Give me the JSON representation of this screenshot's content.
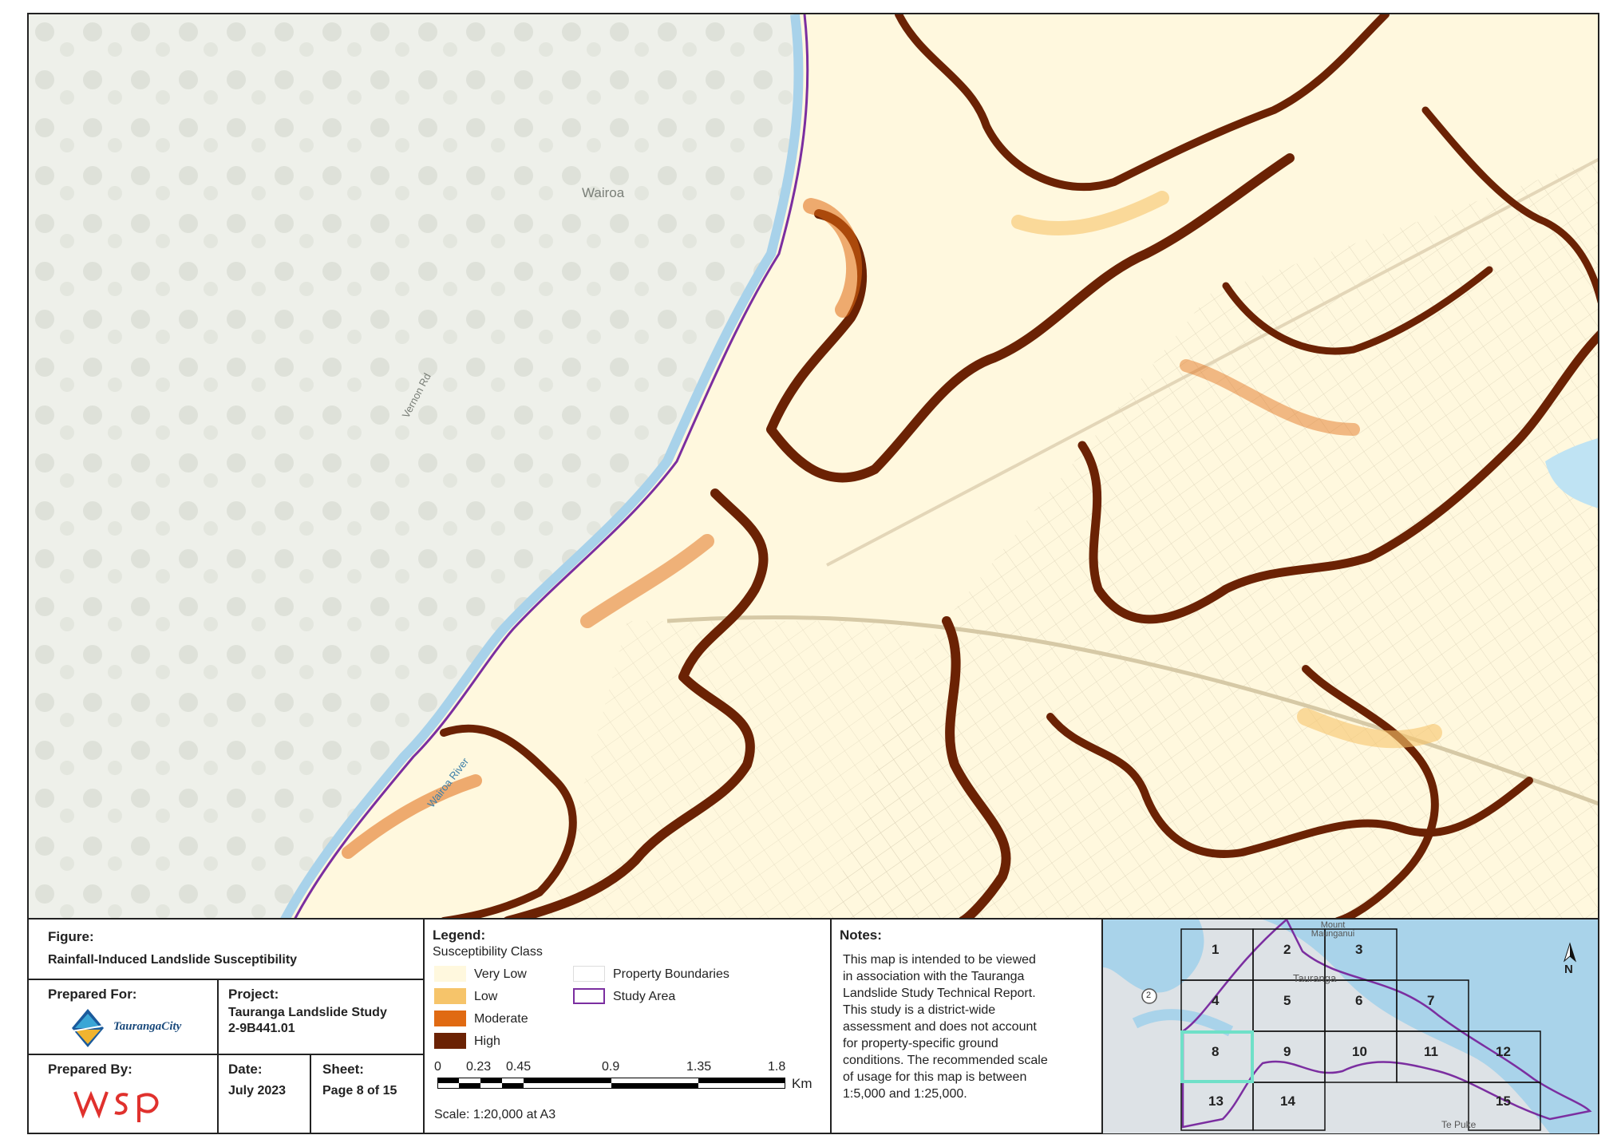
{
  "map": {
    "place_labels": [
      "Wairoa",
      "Vernon Rd",
      "Wairoa River"
    ]
  },
  "figure": {
    "heading": "Figure:",
    "title": "Rainfall-Induced Landslide Susceptibility"
  },
  "prepared_for": {
    "heading": "Prepared For:",
    "logo_text": "TaurangaCity"
  },
  "project": {
    "heading": "Project:",
    "name": "Tauranga Landslide Study",
    "code": "2-9B441.01"
  },
  "prepared_by": {
    "heading": "Prepared By:",
    "logo_text": "wsp"
  },
  "date": {
    "heading": "Date:",
    "value": "July 2023"
  },
  "sheet": {
    "heading": "Sheet:",
    "value": "Page 8 of 15"
  },
  "legend": {
    "heading": "Legend:",
    "subheading": "Susceptibility Class",
    "classes": [
      {
        "label": "Very Low",
        "color": "#fff8de"
      },
      {
        "label": "Low",
        "color": "#f6c46a"
      },
      {
        "label": "Moderate",
        "color": "#e06a12"
      },
      {
        "label": "High",
        "color": "#6b2204"
      }
    ],
    "other": [
      {
        "label": "Property Boundaries",
        "color": "#ffffff"
      },
      {
        "label": "Study Area",
        "color": "#7b2ea0"
      }
    ],
    "scale_ticks": [
      "0",
      "0.23",
      "0.45",
      "0.9",
      "1.35",
      "1.8"
    ],
    "scale_unit": "Km",
    "scale_text": "Scale: 1:20,000 at A3"
  },
  "notes": {
    "heading": "Notes:",
    "lines": [
      "This map is intended to be viewed",
      "in association with the Tauranga",
      "Landslide Study Technical Report.",
      "This study is a district-wide",
      "assessment and does not account",
      "for property-specific ground",
      "conditions. The recommended scale",
      "of usage for this map is between",
      "1:5,000 and 1:25,000."
    ]
  },
  "index_map": {
    "labels": [
      "Mount Maunganui",
      "Tauranga",
      "Te Puke",
      "2"
    ],
    "sheets": [
      "1",
      "2",
      "3",
      "4",
      "5",
      "6",
      "7",
      "8",
      "9",
      "10",
      "11",
      "12",
      "13",
      "14",
      "15"
    ],
    "current_sheet": "8",
    "north": "N"
  }
}
